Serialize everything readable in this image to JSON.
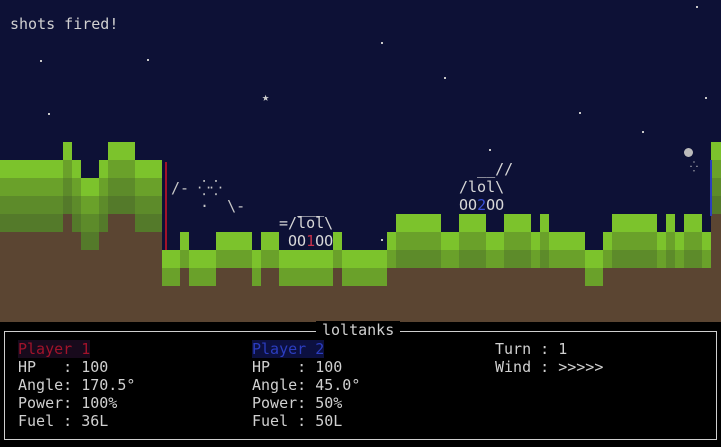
{
  "message": "shots fired!",
  "panel": {
    "title": "loltanks",
    "player1": {
      "name": "Player 1",
      "hp": "HP   : 100",
      "angle": "Angle: 170.5°",
      "power": "Power: 100%",
      "fuel": "Fuel : 36L",
      "color": "#a1132a"
    },
    "player2": {
      "name": "Player 2",
      "hp": "HP   : 100",
      "angle": "Angle: 45.0°",
      "power": "Power: 50%",
      "fuel": "Fuel : 50L",
      "color": "#2b3dbf"
    },
    "turn": "Turn : 1",
    "wind": "Wind : >>>>>"
  },
  "tank1": {
    "top": " ___",
    "mid": "=/lol\\",
    "bot_left": "OO",
    "bot_mid": "1",
    "bot_right": "OO",
    "marker_color": "#a1132a"
  },
  "tank2": {
    "top": "  __//",
    "mid": "/lol\\",
    "bot_left": "OO",
    "bot_mid": "2",
    "bot_right": "OO",
    "marker_color": "#2b3dbf"
  },
  "trail": {
    "line1": "/- ⁛⁛",
    "line2": "  ·  \\-"
  },
  "colors": {
    "sky": "#0d1136",
    "grass": "#7cc32c",
    "dirt": "#5b4532"
  }
}
